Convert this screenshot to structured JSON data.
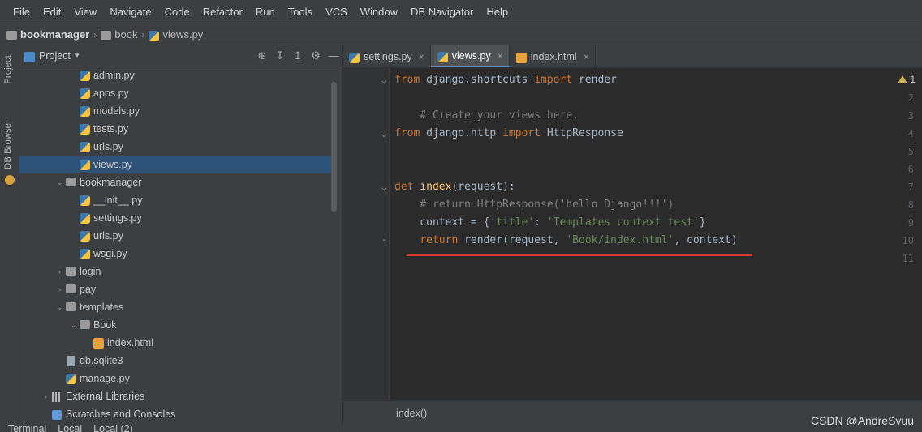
{
  "menubar": {
    "items": [
      {
        "label": "File"
      },
      {
        "label": "Edit"
      },
      {
        "label": "View"
      },
      {
        "label": "Navigate"
      },
      {
        "label": "Code"
      },
      {
        "label": "Refactor"
      },
      {
        "label": "Run"
      },
      {
        "label": "Tools"
      },
      {
        "label": "VCS"
      },
      {
        "label": "Window"
      },
      {
        "label": "DB Navigator"
      },
      {
        "label": "Help"
      }
    ]
  },
  "breadcrumb": {
    "items": [
      {
        "label": "bookmanager",
        "icon": "folder-icon"
      },
      {
        "label": "book",
        "icon": "folder-icon"
      },
      {
        "label": "views.py",
        "icon": "python-file-icon"
      }
    ],
    "separator": "›"
  },
  "left_strip": {
    "tabs": [
      {
        "label": "Project",
        "icon": "project-icon"
      },
      {
        "label": "DB Browser",
        "icon": "database-icon"
      }
    ]
  },
  "project_panel": {
    "title": "Project",
    "chevron": "▾",
    "toolbar_icons": [
      {
        "name": "locate-icon",
        "glyph": "⊕"
      },
      {
        "name": "expand-all-icon",
        "glyph": "↧"
      },
      {
        "name": "collapse-all-icon",
        "glyph": "↥"
      },
      {
        "name": "settings-gear-icon",
        "glyph": "⚙"
      },
      {
        "name": "hide-panel-icon",
        "glyph": "—"
      }
    ],
    "tree": [
      {
        "label": "admin.py",
        "indent": 3,
        "arrow": "",
        "icon": "python-file-icon",
        "selected": false
      },
      {
        "label": "apps.py",
        "indent": 3,
        "arrow": "",
        "icon": "python-file-icon",
        "selected": false
      },
      {
        "label": "models.py",
        "indent": 3,
        "arrow": "",
        "icon": "python-file-icon",
        "selected": false
      },
      {
        "label": "tests.py",
        "indent": 3,
        "arrow": "",
        "icon": "python-file-icon",
        "selected": false
      },
      {
        "label": "urls.py",
        "indent": 3,
        "arrow": "",
        "icon": "python-file-icon",
        "selected": false
      },
      {
        "label": "views.py",
        "indent": 3,
        "arrow": "",
        "icon": "python-file-icon",
        "selected": true
      },
      {
        "label": "bookmanager",
        "indent": 2,
        "arrow": "⌄",
        "icon": "folder-icon",
        "selected": false
      },
      {
        "label": "__init__.py",
        "indent": 3,
        "arrow": "",
        "icon": "python-file-icon",
        "selected": false
      },
      {
        "label": "settings.py",
        "indent": 3,
        "arrow": "",
        "icon": "python-file-icon",
        "selected": false
      },
      {
        "label": "urls.py",
        "indent": 3,
        "arrow": "",
        "icon": "python-file-icon",
        "selected": false
      },
      {
        "label": "wsgi.py",
        "indent": 3,
        "arrow": "",
        "icon": "python-file-icon",
        "selected": false
      },
      {
        "label": "login",
        "indent": 2,
        "arrow": "›",
        "icon": "folder-icon",
        "selected": false
      },
      {
        "label": "pay",
        "indent": 2,
        "arrow": "›",
        "icon": "folder-icon",
        "selected": false
      },
      {
        "label": "templates",
        "indent": 2,
        "arrow": "⌄",
        "icon": "folder-icon",
        "selected": false
      },
      {
        "label": "Book",
        "indent": 3,
        "arrow": "⌄",
        "icon": "folder-icon",
        "selected": false
      },
      {
        "label": "index.html",
        "indent": 4,
        "arrow": "",
        "icon": "html-file-icon",
        "selected": false
      },
      {
        "label": "db.sqlite3",
        "indent": 2,
        "arrow": "",
        "icon": "database-file-icon",
        "selected": false
      },
      {
        "label": "manage.py",
        "indent": 2,
        "arrow": "",
        "icon": "python-file-icon",
        "selected": false
      },
      {
        "label": "External Libraries",
        "indent": 1,
        "arrow": "›",
        "icon": "library-icon",
        "selected": false
      },
      {
        "label": "Scratches and Consoles",
        "indent": 1,
        "arrow": "",
        "icon": "scratches-icon",
        "selected": false
      }
    ]
  },
  "editor_tabs": [
    {
      "label": "settings.py",
      "icon": "python-file-icon",
      "active": false,
      "close": "×"
    },
    {
      "label": "views.py",
      "icon": "python-file-icon",
      "active": true,
      "close": "×"
    },
    {
      "label": "index.html",
      "icon": "html-file-icon",
      "active": false,
      "close": "×"
    }
  ],
  "editor": {
    "line_numbers": [
      "1",
      "2",
      "3",
      "4",
      "5",
      "6",
      "7",
      "8",
      "9",
      "10",
      "11"
    ],
    "fold_markers": {
      "1": "⌄",
      "4": "⌄",
      "7": "⌄",
      "10": "·"
    },
    "warning_count": "1",
    "warning_icon": "warning-triangle-icon",
    "lines": [
      {
        "n": 1,
        "tokens": [
          {
            "t": "from",
            "c": "kw"
          },
          {
            "t": " django.shortcuts ",
            "c": "pl"
          },
          {
            "t": "import",
            "c": "kw"
          },
          {
            "t": " render",
            "c": "pl"
          }
        ]
      },
      {
        "n": 2,
        "tokens": []
      },
      {
        "n": 3,
        "tokens": [
          {
            "t": "    # Create your views here.",
            "c": "cmt"
          }
        ]
      },
      {
        "n": 4,
        "tokens": [
          {
            "t": "from",
            "c": "kw"
          },
          {
            "t": " django.http ",
            "c": "pl"
          },
          {
            "t": "import",
            "c": "kw"
          },
          {
            "t": " HttpResponse",
            "c": "pl"
          }
        ]
      },
      {
        "n": 5,
        "tokens": []
      },
      {
        "n": 6,
        "tokens": []
      },
      {
        "n": 7,
        "tokens": [
          {
            "t": "def ",
            "c": "kw"
          },
          {
            "t": "index",
            "c": "fn"
          },
          {
            "t": "(request):",
            "c": "pl"
          }
        ]
      },
      {
        "n": 8,
        "tokens": [
          {
            "t": "    # return HttpResponse('hello Django!!!')",
            "c": "cmt"
          }
        ]
      },
      {
        "n": 9,
        "tokens": [
          {
            "t": "    context = {",
            "c": "pl"
          },
          {
            "t": "'title'",
            "c": "str"
          },
          {
            "t": ": ",
            "c": "pl"
          },
          {
            "t": "'Templates context test'",
            "c": "str"
          },
          {
            "t": "}",
            "c": "pl"
          }
        ]
      },
      {
        "n": 10,
        "tokens": [
          {
            "t": "    ",
            "c": "pl"
          },
          {
            "t": "return ",
            "c": "kw"
          },
          {
            "t": "render(request, ",
            "c": "pl"
          },
          {
            "t": "'Book/index.html'",
            "c": "str"
          },
          {
            "t": ", context)",
            "c": "pl"
          }
        ]
      },
      {
        "n": 11,
        "tokens": []
      }
    ],
    "annotation": {
      "name": "red-underline-highlight",
      "color": "#e03a2f"
    }
  },
  "status_bar": {
    "breadcrumb": "index()"
  },
  "watermark": {
    "text": "CSDN @AndreSyuu"
  },
  "bottom_bar": {
    "items": [
      {
        "label": "Terminal"
      },
      {
        "label": "Local"
      },
      {
        "label": "Local (2)"
      }
    ]
  }
}
